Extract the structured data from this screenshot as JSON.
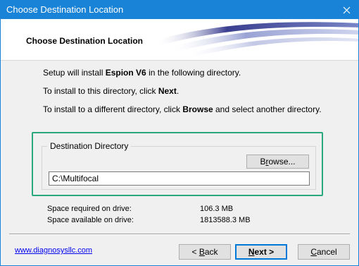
{
  "window": {
    "title": "Choose Destination Location"
  },
  "header": {
    "title": "Choose Destination Location"
  },
  "body": {
    "line1_pre": "Setup will install ",
    "line1_bold": "Espion V6",
    "line1_post": " in the following directory.",
    "line2_pre": "To install to this directory, click ",
    "line2_bold": "Next",
    "line2_post": ".",
    "line3_pre": "To install to a different directory, click ",
    "line3_bold": "Browse",
    "line3_post": " and select another directory."
  },
  "destination": {
    "group_label": "Destination Directory",
    "browse_pre": "B",
    "browse_ak": "r",
    "browse_post": "owse...",
    "path": "C:\\Multifocal"
  },
  "space": {
    "required_label": "Space required on drive:",
    "required_value": "106.3 MB",
    "available_label": "Space available on drive:",
    "available_value": "1813588.3 MB"
  },
  "footer": {
    "link": "www.diagnosysllc.com",
    "back_ak": "< ",
    "back_u": "B",
    "back_post": "ack",
    "next_u": "N",
    "next_post": "ext >",
    "cancel_u": "C",
    "cancel_post": "ancel"
  },
  "colors": {
    "titlebar": "#1883d7",
    "highlight": "#2aa77f",
    "link": "#0000ee"
  }
}
